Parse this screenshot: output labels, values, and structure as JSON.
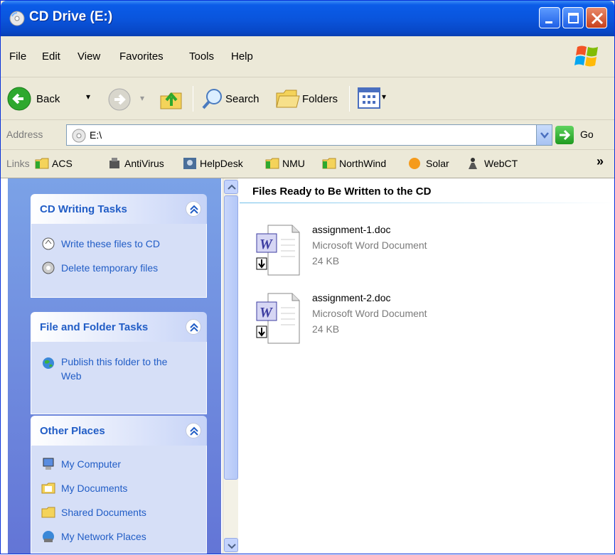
{
  "window": {
    "title": "CD Drive (E:)"
  },
  "menu": [
    "File",
    "Edit",
    "View",
    "Favorites",
    "Tools",
    "Help"
  ],
  "toolbar": {
    "back_label": "Back",
    "search_label": "Search",
    "folders_label": "Folders"
  },
  "address": {
    "label": "Address",
    "value": "E:\\",
    "go_label": "Go"
  },
  "links": {
    "label": "Links",
    "items": [
      "ACS",
      "AntiVirus",
      "HelpDesk",
      "NMU",
      "NorthWind",
      "Solar",
      "WebCT"
    ]
  },
  "sidebar": {
    "cd_tasks": {
      "title": "CD Writing Tasks",
      "items": [
        "Write these files to CD",
        "Delete temporary files"
      ]
    },
    "file_tasks": {
      "title": "File and Folder Tasks",
      "items": [
        "Publish this folder to the Web"
      ]
    },
    "other_places": {
      "title": "Other Places",
      "items": [
        "My Computer",
        "My Documents",
        "Shared Documents",
        "My Network Places"
      ]
    }
  },
  "main": {
    "group_title": "Files Ready to Be Written to the CD",
    "files": [
      {
        "name": "assignment-1.doc",
        "type": "Microsoft Word Document",
        "size": "24 KB"
      },
      {
        "name": "assignment-2.doc",
        "type": "Microsoft Word Document",
        "size": "24 KB"
      }
    ]
  },
  "colors": {
    "titlebar": "#0a55dd",
    "sidebar_top": "#7ba2e7",
    "sidebar_bottom": "#6375d6",
    "task_link": "#215dc6",
    "panel_body": "#d6dff7"
  },
  "icons": [
    "cd-drive-icon",
    "minimize-icon",
    "maximize-icon",
    "close-icon",
    "windows-logo-icon",
    "back-arrow-icon",
    "forward-arrow-icon",
    "up-folder-icon",
    "search-icon",
    "folders-icon",
    "views-icon",
    "go-arrow-icon",
    "word-document-icon"
  ]
}
